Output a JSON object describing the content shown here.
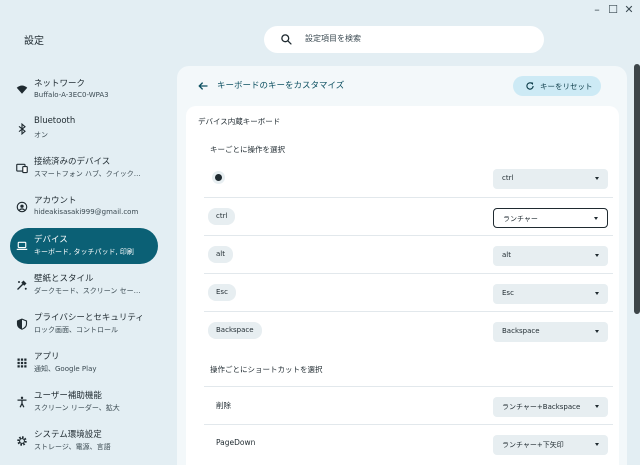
{
  "window": {
    "app_title": "設定",
    "controls": {
      "minimize": "–",
      "maximize": "☐",
      "close": "✕"
    }
  },
  "search": {
    "placeholder": "設定項目を検索"
  },
  "sidebar": {
    "items": [
      {
        "title": "ネットワーク",
        "subtitle": "Buffalo-A-3EC0-WPA3",
        "icon": "wifi-icon"
      },
      {
        "title": "Bluetooth",
        "subtitle": "オン",
        "icon": "bluetooth-icon"
      },
      {
        "title": "接続済みのデバイス",
        "subtitle": "スマートフォン ハブ、クイック…",
        "icon": "connected-devices-icon"
      },
      {
        "title": "アカウント",
        "subtitle": "hideakisasaki999@gmail.com",
        "icon": "account-icon"
      },
      {
        "title": "デバイス",
        "subtitle": "キーボード, タッチパッド, 印刷",
        "icon": "laptop-icon",
        "active": true
      },
      {
        "title": "壁紙とスタイル",
        "subtitle": "ダークモード、スクリーン セー…",
        "icon": "palette-icon"
      },
      {
        "title": "プライバシーとセキュリティ",
        "subtitle": "ロック画面、コントロール",
        "icon": "shield-icon"
      },
      {
        "title": "アプリ",
        "subtitle": "通知、Google Play",
        "icon": "apps-grid-icon"
      },
      {
        "title": "ユーザー補助機能",
        "subtitle": "スクリーン リーダー、拡大",
        "icon": "accessibility-icon"
      },
      {
        "title": "システム環境設定",
        "subtitle": "ストレージ、電源、言語",
        "icon": "system-gear-icon"
      }
    ]
  },
  "main": {
    "title": "キーボードのキーをカスタマイズ",
    "reset_label": "キーをリセット",
    "device_section": "デバイス内蔵キーボード",
    "per_key_section": "キーごとに操作を選択",
    "key_rows": [
      {
        "key": "",
        "kind": "radio",
        "value": "ctrl"
      },
      {
        "key": "ctrl",
        "kind": "chip",
        "value": "ランチャー",
        "focused": true
      },
      {
        "key": "alt",
        "kind": "chip",
        "value": "alt"
      },
      {
        "key": "Esc",
        "kind": "chip",
        "value": "Esc"
      },
      {
        "key": "Backspace",
        "kind": "chip",
        "value": "Backspace"
      }
    ],
    "shortcut_section": "操作ごとにショートカットを選択",
    "shortcut_rows": [
      {
        "action": "削除",
        "value": "ランチャー+Backspace"
      },
      {
        "action": "PageDown",
        "value": "ランチャー+下矢印"
      }
    ]
  },
  "colors": {
    "accent": "#0b6075",
    "background": "#e3eef3",
    "card": "#ffffff",
    "chip": "#e7eef1"
  }
}
